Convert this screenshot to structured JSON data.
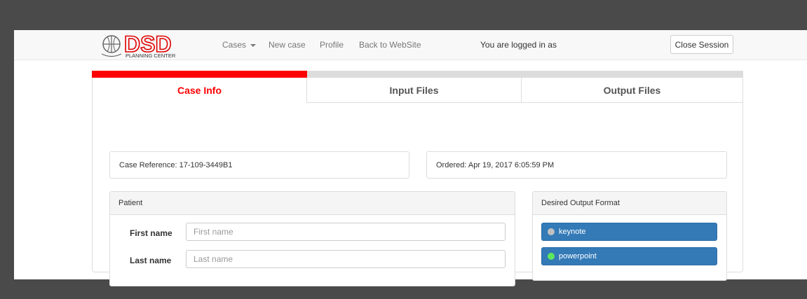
{
  "navbar": {
    "logo_text": "DSD",
    "logo_subtext": "PLANNING CENTER",
    "links": {
      "cases": "Cases",
      "new_case": "New case",
      "profile": "Profile",
      "back_to_website": "Back to WebSite"
    },
    "logged_in_text": "You are logged in as",
    "close_session": "Close Session"
  },
  "progress": {
    "fraction": 0.33,
    "fill_color": "#ff0000",
    "track_color": "#dcdcdc"
  },
  "tabs": [
    {
      "label": "Case Info",
      "active": true
    },
    {
      "label": "Input Files",
      "active": false
    },
    {
      "label": "Output Files",
      "active": false
    }
  ],
  "case_info": {
    "reference": "Case Reference: 17-109-3449B1",
    "ordered": "Ordered: Apr 19, 2017 6:05:59 PM"
  },
  "patient": {
    "heading": "Patient",
    "first_name_label": "First name",
    "first_name_placeholder": "First name",
    "first_name_value": "",
    "last_name_label": "Last name",
    "last_name_placeholder": "Last name",
    "last_name_value": ""
  },
  "output_format": {
    "heading": "Desired Output Format",
    "options": [
      {
        "label": "keynote",
        "dot_color": "#c0c0c0"
      },
      {
        "label": "powerpoint",
        "dot_color": "#5ee85e"
      }
    ],
    "button_color": "#337ab7"
  }
}
